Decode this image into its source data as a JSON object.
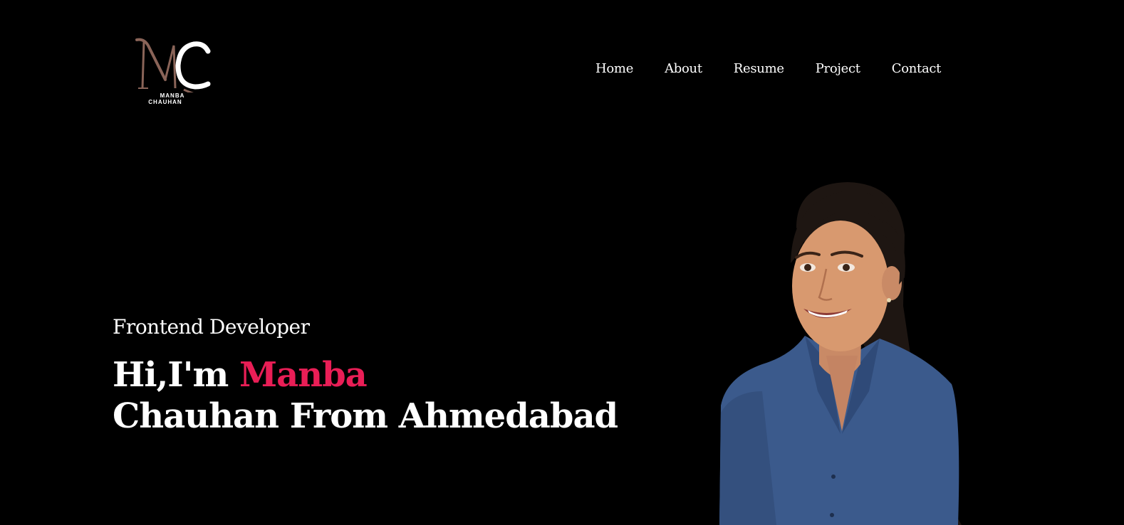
{
  "logo": {
    "monogram": "MC",
    "line1": "MANBA",
    "line2": "CHAUHAN",
    "colors": {
      "m": "#8a6458",
      "c": "#ffffff"
    }
  },
  "nav": {
    "items": [
      {
        "label": "Home"
      },
      {
        "label": "About"
      },
      {
        "label": "Resume"
      },
      {
        "label": "Project"
      },
      {
        "label": "Contact"
      }
    ]
  },
  "hero": {
    "subtitle": "Frontend Developer",
    "greeting": "Hi,I'm ",
    "name_accent": "Manba",
    "line2": "Chauhan From Ahmedabad",
    "accent_color": "#e91e56"
  },
  "portrait": {
    "subject": "woman in blue shirt smiling"
  }
}
